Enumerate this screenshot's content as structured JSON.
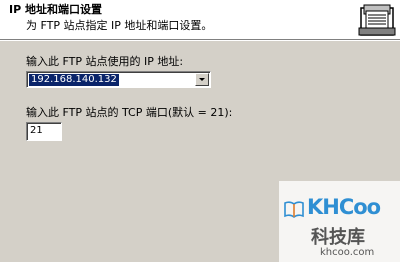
{
  "wizard": {
    "title": "IP 地址和端口设置",
    "subtitle": "为 FTP 站点指定 IP 地址和端口设置。",
    "header_icon": "ftp-site-icon"
  },
  "ip_address": {
    "label": "输入此 FTP 站点使用的 IP 地址:",
    "selected_value": "192.168.140.132"
  },
  "tcp_port": {
    "label": "输入此 FTP 站点的 TCP 端口(默认 = 21):",
    "value": "21"
  },
  "watermark": {
    "logo": "KHCoo",
    "name_cn": "科技库",
    "url": "khcoo.com",
    "logo_color": "#2f8fd3"
  },
  "colors": {
    "dialog_background": "#d4d0c8",
    "selection": "#0a246a"
  }
}
